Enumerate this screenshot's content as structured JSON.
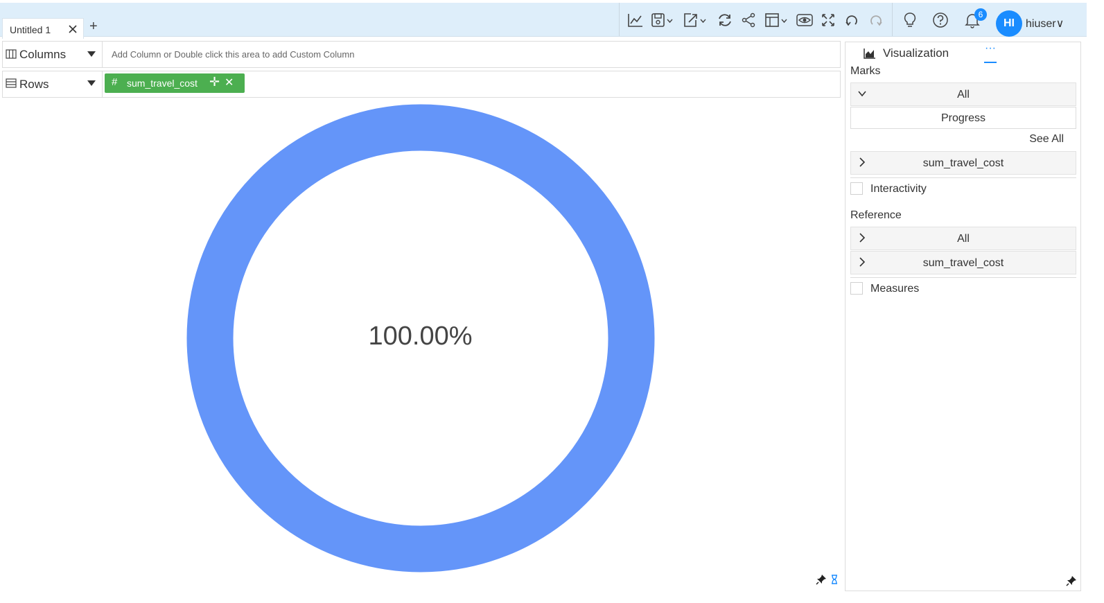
{
  "tabs": [
    {
      "label": "Untitled 1"
    }
  ],
  "toolbar": {
    "tools": [
      "line-chart-icon",
      "save-icon",
      "export-icon",
      "refresh-icon",
      "share-icon",
      "layout-icon",
      "preview-icon",
      "fullscreen-icon",
      "undo-icon",
      "redo-icon",
      "lightbulb-icon",
      "help-icon",
      "bell-icon"
    ],
    "notification_count": "6",
    "avatar_initials": "HI",
    "username": "hiuser"
  },
  "shelves": {
    "columns": {
      "label": "Columns",
      "hint": "Add Column or Double click this area to add Custom Column"
    },
    "rows": {
      "label": "Rows",
      "pill": "sum_travel_cost"
    }
  },
  "chart": {
    "center_label": "100.00%",
    "accent": "#6495f9"
  },
  "chart_data": {
    "type": "pie",
    "variant": "donut-progress",
    "categories": [
      "sum_travel_cost"
    ],
    "values": [
      100
    ],
    "center_text": "100.00%",
    "color": "#6495f9"
  },
  "panel": {
    "tab_label": "Visualization",
    "more_label": "···",
    "marks_title": "Marks",
    "marks_all": "All",
    "marks_type": "Progress",
    "see_all": "See All",
    "marks_field": "sum_travel_cost",
    "interactivity": "Interactivity",
    "reference_title": "Reference",
    "ref_all": "All",
    "ref_field": "sum_travel_cost",
    "measures": "Measures"
  }
}
